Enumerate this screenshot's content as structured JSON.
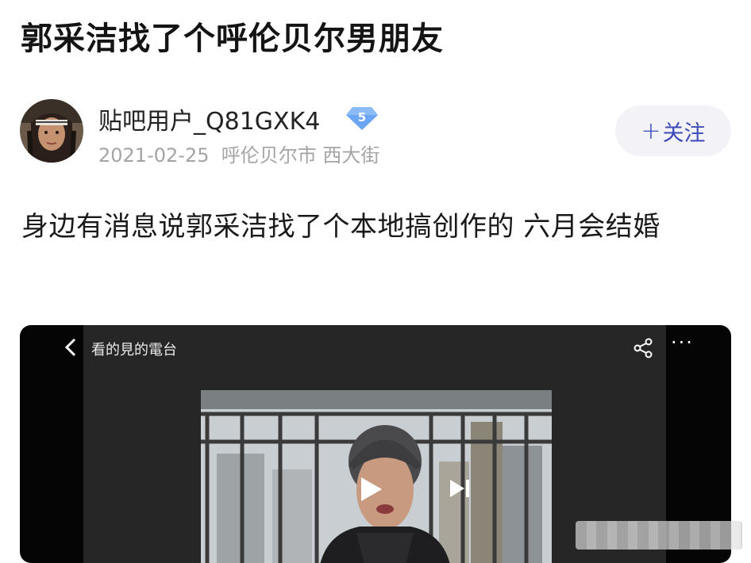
{
  "post": {
    "title": "郭采洁找了个呼伦贝尔男朋友",
    "author": {
      "name": "贴吧用户_Q81GXK4",
      "level": "5",
      "avatar_icon": "avatar-portrait"
    },
    "date": "2021-02-25",
    "location": "呼伦贝尔市 西大街",
    "follow_label": "关注",
    "follow_icon": "plus-icon",
    "body": "身边有消息说郭采洁找了个本地搞创作的 六月会结婚"
  },
  "video": {
    "channel": "看的見的電台",
    "icons": [
      "back-icon",
      "share-icon",
      "more-icon",
      "play-icon",
      "next-icon"
    ]
  },
  "colors": {
    "follow_text": "#3b4ab8",
    "follow_bg": "#f3f3f7",
    "badge": "#5b9af0",
    "meta_text": "#a4a4a4",
    "video_bg": "#050505"
  }
}
